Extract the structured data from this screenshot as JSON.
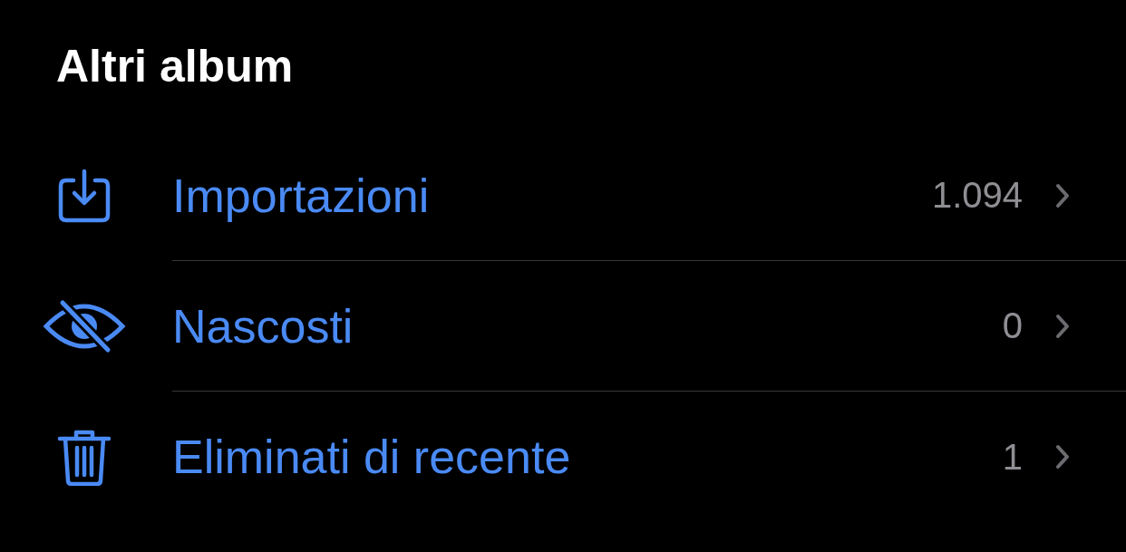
{
  "title": "Altri album",
  "items": [
    {
      "kind": "imports",
      "label": "Importazioni",
      "count": "1.094"
    },
    {
      "kind": "hidden",
      "label": "Nascosti",
      "count": "0"
    },
    {
      "kind": "deleted",
      "label": "Eliminati di recente",
      "count": "1"
    }
  ]
}
